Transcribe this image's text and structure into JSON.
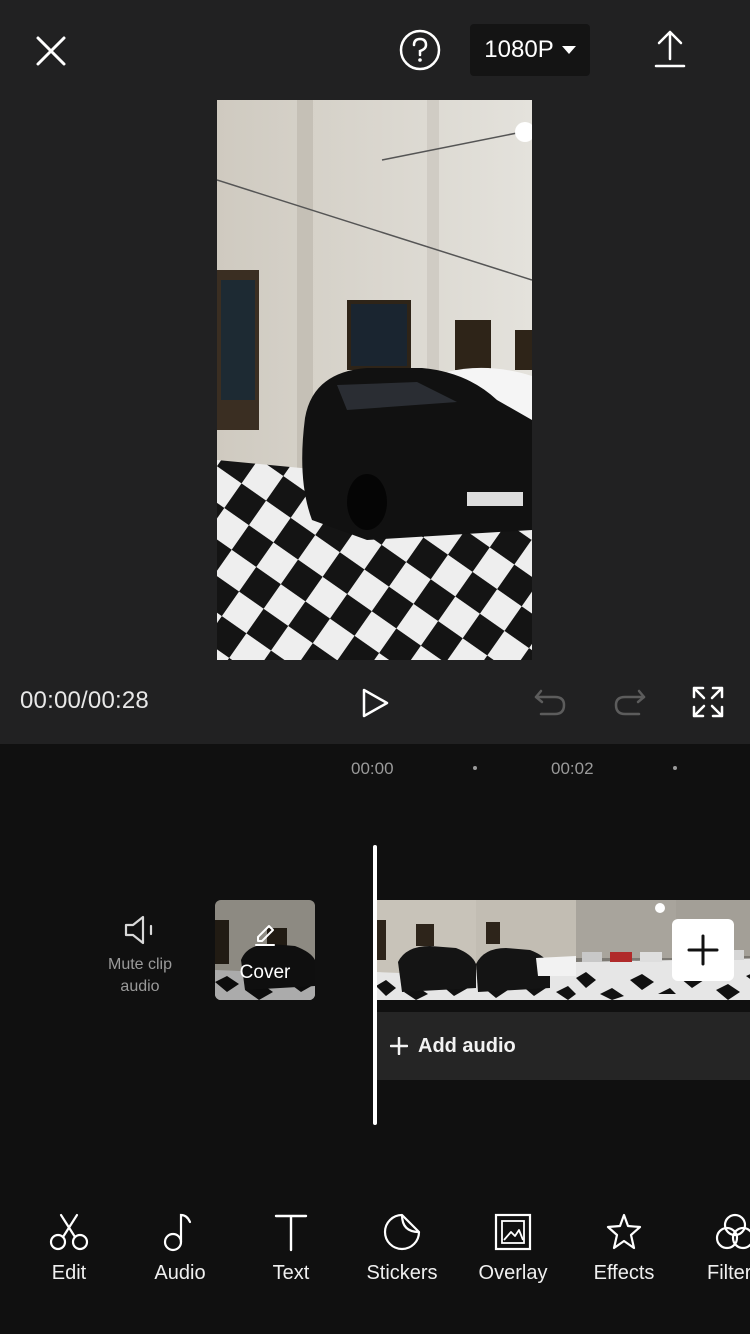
{
  "header": {
    "close_icon": "close-icon",
    "help_icon": "help-icon",
    "resolution": "1080P",
    "export_icon": "export-icon"
  },
  "playback": {
    "time": "00:00/00:28",
    "play_icon": "play-icon",
    "undo_icon": "undo-icon",
    "redo_icon": "redo-icon",
    "fullscreen_icon": "fullscreen-icon"
  },
  "ruler": {
    "ticks": [
      "00:00",
      "00:02"
    ]
  },
  "timeline": {
    "mute_label_line1": "Mute clip",
    "mute_label_line2": "audio",
    "cover_label": "Cover",
    "add_audio_label": "Add audio"
  },
  "toolbar": {
    "items": [
      {
        "label": "Edit",
        "icon": "scissors-icon"
      },
      {
        "label": "Audio",
        "icon": "music-note-icon"
      },
      {
        "label": "Text",
        "icon": "text-icon"
      },
      {
        "label": "Stickers",
        "icon": "sticker-icon"
      },
      {
        "label": "Overlay",
        "icon": "overlay-icon"
      },
      {
        "label": "Effects",
        "icon": "effects-star-icon"
      },
      {
        "label": "Filter",
        "icon": "filter-icon"
      }
    ]
  },
  "colors": {
    "editor_bg": "#212122",
    "timeline_bg": "#101010",
    "audio_track": "#252525"
  }
}
